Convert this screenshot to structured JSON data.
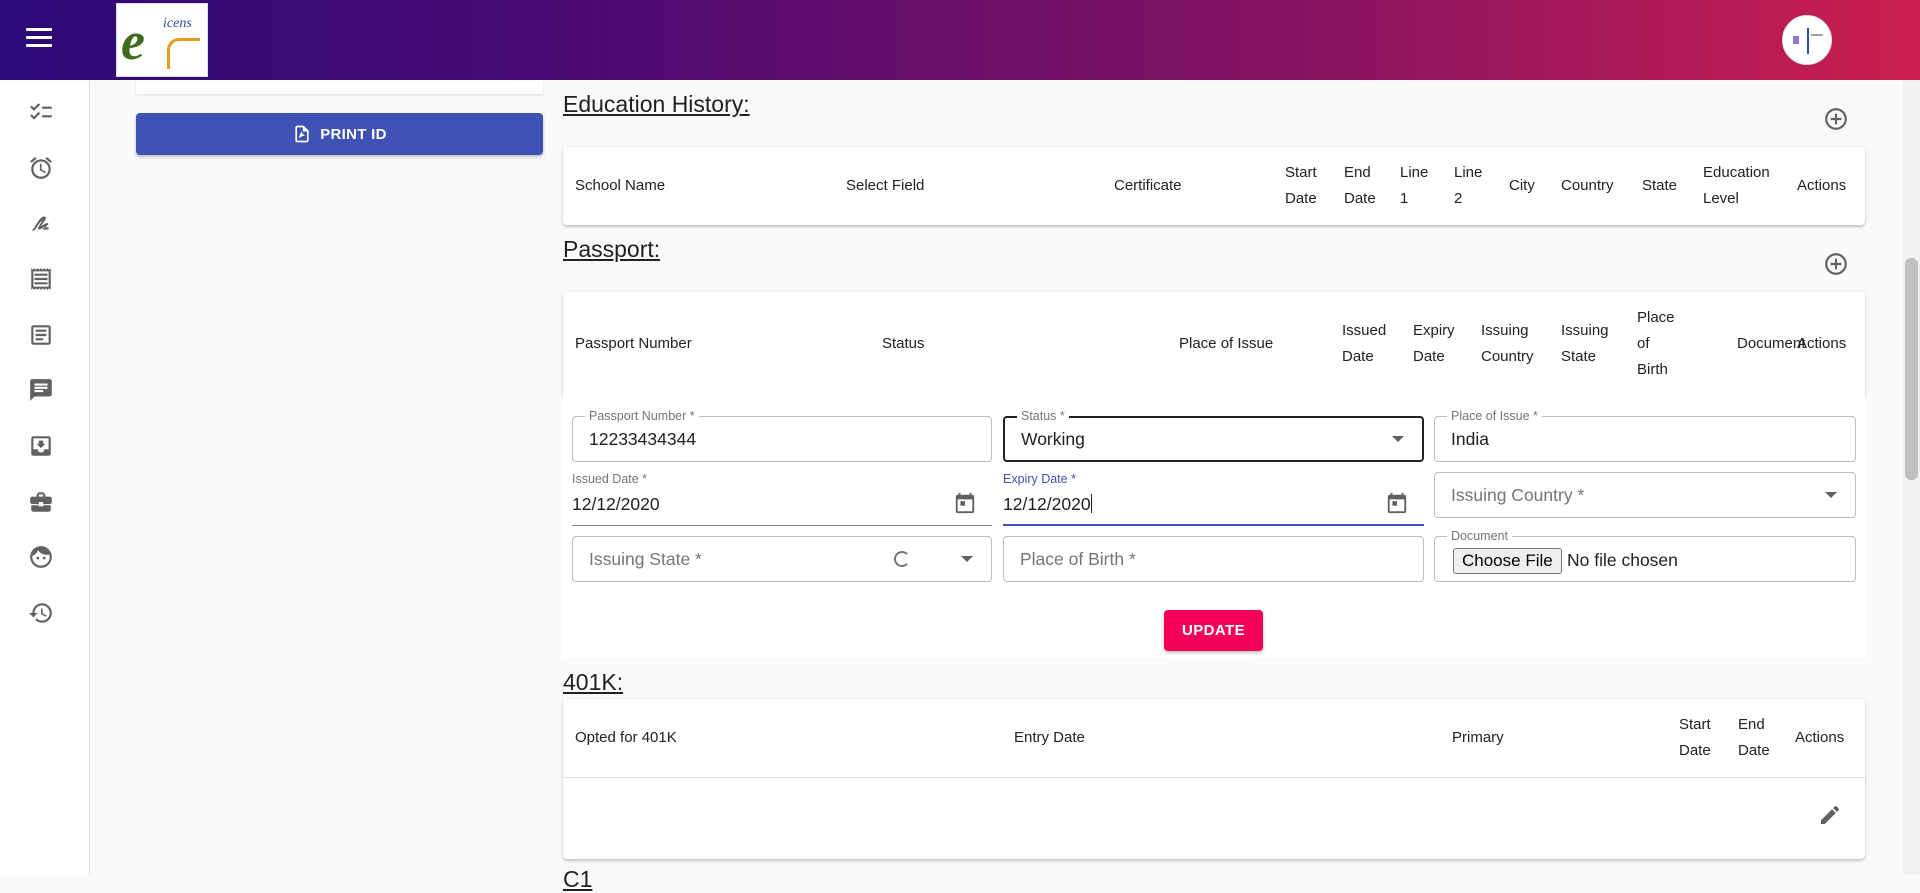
{
  "header": {
    "menu_icon": "hamburger-menu-icon",
    "logo_text": "e",
    "logo_sub": "icens",
    "avatar_icon": "user-avatar"
  },
  "sidebar": {
    "icons": [
      "checklist-icon",
      "alarm-icon",
      "signature-icon",
      "receipt-icon",
      "document-icon",
      "chat-icon",
      "inbox-icon",
      "briefcase-icon",
      "face-icon",
      "history-icon"
    ]
  },
  "left_panel": {
    "print_label": "PRINT ID"
  },
  "education": {
    "title": "Education History:",
    "columns": [
      "School Name",
      "Select Field",
      "Certificate",
      "Start Date",
      "End Date",
      "Line 1",
      "Line 2",
      "City",
      "Country",
      "State",
      "Education Level",
      "Actions"
    ]
  },
  "passport": {
    "title": "Passport:",
    "columns": [
      "Passport Number",
      "Status",
      "Place of Issue",
      "Issued Date",
      "Expiry Date",
      "Issuing Country",
      "Issuing State",
      "Place of Birth",
      "Document",
      "Actions"
    ],
    "form": {
      "passport_number": {
        "label": "Passport Number *",
        "value": "12233434344"
      },
      "status": {
        "label": "Status *",
        "value": "Working"
      },
      "place_of_issue": {
        "label": "Place of Issue *",
        "value": "India"
      },
      "issued_date": {
        "label": "Issued Date *",
        "value": "12/12/2020"
      },
      "expiry_date": {
        "label": "Expiry Date *",
        "value": "12/12/2020"
      },
      "issuing_country": {
        "placeholder": "Issuing Country *"
      },
      "issuing_state": {
        "placeholder": "Issuing State *"
      },
      "place_of_birth": {
        "placeholder": "Place of Birth *"
      },
      "document": {
        "label": "Document",
        "button": "Choose File",
        "status": "No file chosen"
      }
    },
    "update_label": "UPDATE"
  },
  "k401": {
    "title": "401K:",
    "columns": [
      "Opted for 401K",
      "Entry Date",
      "Primary",
      "Start Date",
      "End Date",
      "Actions"
    ]
  },
  "next_section_fragment": "C1"
}
